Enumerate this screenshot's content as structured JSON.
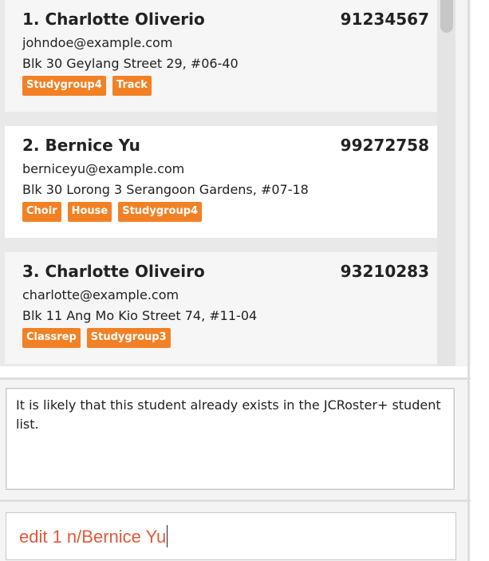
{
  "persons": [
    {
      "name": "1. Charlotte Oliverio",
      "phone": "91234567",
      "email": "johndoe@example.com",
      "address": "Blk 30 Geylang Street 29, #06-40",
      "tags": [
        "Studygroup4",
        "Track"
      ]
    },
    {
      "name": "2. Bernice Yu",
      "phone": "99272758",
      "email": "berniceyu@example.com",
      "address": "Blk 30 Lorong 3 Serangoon Gardens, #07-18",
      "tags": [
        "Choir",
        "House",
        "Studygroup4"
      ]
    },
    {
      "name": "3. Charlotte Oliveiro",
      "phone": "93210283",
      "email": "charlotte@example.com",
      "address": "Blk 11 Ang Mo Kio Street 74, #11-04",
      "tags": [
        "Classrep",
        "Studygroup3"
      ]
    }
  ],
  "result_display": {
    "text": "It is likely that this student already exists in the JCRoster+ student list."
  },
  "command_box": {
    "value": "edit 1 n/Bernice Yu"
  },
  "colors": {
    "tag_background": "#f28125",
    "command_text": "#e05a3a"
  }
}
